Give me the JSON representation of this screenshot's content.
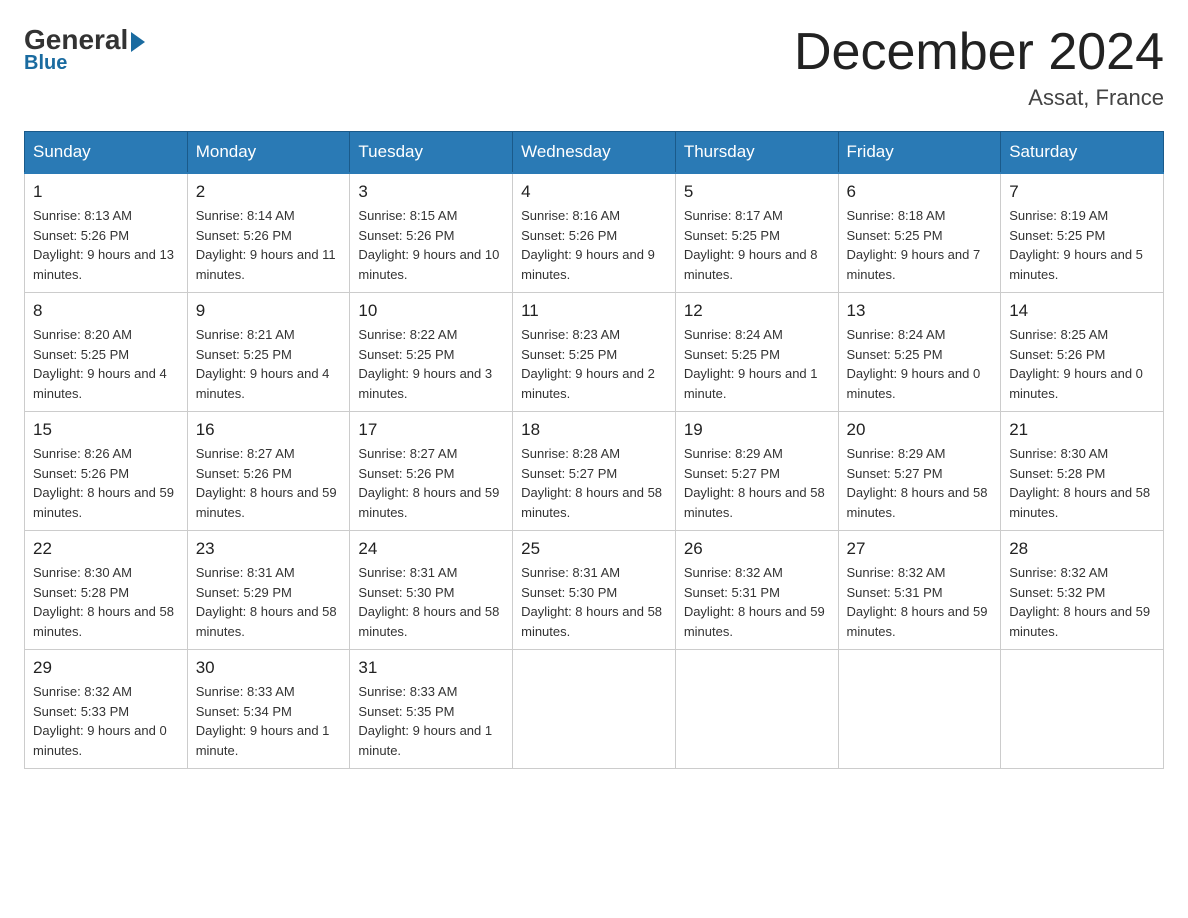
{
  "logo": {
    "general": "General",
    "blue": "Blue"
  },
  "header": {
    "month": "December 2024",
    "location": "Assat, France"
  },
  "days_of_week": [
    "Sunday",
    "Monday",
    "Tuesday",
    "Wednesday",
    "Thursday",
    "Friday",
    "Saturday"
  ],
  "weeks": [
    [
      {
        "day": "1",
        "sunrise": "Sunrise: 8:13 AM",
        "sunset": "Sunset: 5:26 PM",
        "daylight": "Daylight: 9 hours and 13 minutes."
      },
      {
        "day": "2",
        "sunrise": "Sunrise: 8:14 AM",
        "sunset": "Sunset: 5:26 PM",
        "daylight": "Daylight: 9 hours and 11 minutes."
      },
      {
        "day": "3",
        "sunrise": "Sunrise: 8:15 AM",
        "sunset": "Sunset: 5:26 PM",
        "daylight": "Daylight: 9 hours and 10 minutes."
      },
      {
        "day": "4",
        "sunrise": "Sunrise: 8:16 AM",
        "sunset": "Sunset: 5:26 PM",
        "daylight": "Daylight: 9 hours and 9 minutes."
      },
      {
        "day": "5",
        "sunrise": "Sunrise: 8:17 AM",
        "sunset": "Sunset: 5:25 PM",
        "daylight": "Daylight: 9 hours and 8 minutes."
      },
      {
        "day": "6",
        "sunrise": "Sunrise: 8:18 AM",
        "sunset": "Sunset: 5:25 PM",
        "daylight": "Daylight: 9 hours and 7 minutes."
      },
      {
        "day": "7",
        "sunrise": "Sunrise: 8:19 AM",
        "sunset": "Sunset: 5:25 PM",
        "daylight": "Daylight: 9 hours and 5 minutes."
      }
    ],
    [
      {
        "day": "8",
        "sunrise": "Sunrise: 8:20 AM",
        "sunset": "Sunset: 5:25 PM",
        "daylight": "Daylight: 9 hours and 4 minutes."
      },
      {
        "day": "9",
        "sunrise": "Sunrise: 8:21 AM",
        "sunset": "Sunset: 5:25 PM",
        "daylight": "Daylight: 9 hours and 4 minutes."
      },
      {
        "day": "10",
        "sunrise": "Sunrise: 8:22 AM",
        "sunset": "Sunset: 5:25 PM",
        "daylight": "Daylight: 9 hours and 3 minutes."
      },
      {
        "day": "11",
        "sunrise": "Sunrise: 8:23 AM",
        "sunset": "Sunset: 5:25 PM",
        "daylight": "Daylight: 9 hours and 2 minutes."
      },
      {
        "day": "12",
        "sunrise": "Sunrise: 8:24 AM",
        "sunset": "Sunset: 5:25 PM",
        "daylight": "Daylight: 9 hours and 1 minute."
      },
      {
        "day": "13",
        "sunrise": "Sunrise: 8:24 AM",
        "sunset": "Sunset: 5:25 PM",
        "daylight": "Daylight: 9 hours and 0 minutes."
      },
      {
        "day": "14",
        "sunrise": "Sunrise: 8:25 AM",
        "sunset": "Sunset: 5:26 PM",
        "daylight": "Daylight: 9 hours and 0 minutes."
      }
    ],
    [
      {
        "day": "15",
        "sunrise": "Sunrise: 8:26 AM",
        "sunset": "Sunset: 5:26 PM",
        "daylight": "Daylight: 8 hours and 59 minutes."
      },
      {
        "day": "16",
        "sunrise": "Sunrise: 8:27 AM",
        "sunset": "Sunset: 5:26 PM",
        "daylight": "Daylight: 8 hours and 59 minutes."
      },
      {
        "day": "17",
        "sunrise": "Sunrise: 8:27 AM",
        "sunset": "Sunset: 5:26 PM",
        "daylight": "Daylight: 8 hours and 59 minutes."
      },
      {
        "day": "18",
        "sunrise": "Sunrise: 8:28 AM",
        "sunset": "Sunset: 5:27 PM",
        "daylight": "Daylight: 8 hours and 58 minutes."
      },
      {
        "day": "19",
        "sunrise": "Sunrise: 8:29 AM",
        "sunset": "Sunset: 5:27 PM",
        "daylight": "Daylight: 8 hours and 58 minutes."
      },
      {
        "day": "20",
        "sunrise": "Sunrise: 8:29 AM",
        "sunset": "Sunset: 5:27 PM",
        "daylight": "Daylight: 8 hours and 58 minutes."
      },
      {
        "day": "21",
        "sunrise": "Sunrise: 8:30 AM",
        "sunset": "Sunset: 5:28 PM",
        "daylight": "Daylight: 8 hours and 58 minutes."
      }
    ],
    [
      {
        "day": "22",
        "sunrise": "Sunrise: 8:30 AM",
        "sunset": "Sunset: 5:28 PM",
        "daylight": "Daylight: 8 hours and 58 minutes."
      },
      {
        "day": "23",
        "sunrise": "Sunrise: 8:31 AM",
        "sunset": "Sunset: 5:29 PM",
        "daylight": "Daylight: 8 hours and 58 minutes."
      },
      {
        "day": "24",
        "sunrise": "Sunrise: 8:31 AM",
        "sunset": "Sunset: 5:30 PM",
        "daylight": "Daylight: 8 hours and 58 minutes."
      },
      {
        "day": "25",
        "sunrise": "Sunrise: 8:31 AM",
        "sunset": "Sunset: 5:30 PM",
        "daylight": "Daylight: 8 hours and 58 minutes."
      },
      {
        "day": "26",
        "sunrise": "Sunrise: 8:32 AM",
        "sunset": "Sunset: 5:31 PM",
        "daylight": "Daylight: 8 hours and 59 minutes."
      },
      {
        "day": "27",
        "sunrise": "Sunrise: 8:32 AM",
        "sunset": "Sunset: 5:31 PM",
        "daylight": "Daylight: 8 hours and 59 minutes."
      },
      {
        "day": "28",
        "sunrise": "Sunrise: 8:32 AM",
        "sunset": "Sunset: 5:32 PM",
        "daylight": "Daylight: 8 hours and 59 minutes."
      }
    ],
    [
      {
        "day": "29",
        "sunrise": "Sunrise: 8:32 AM",
        "sunset": "Sunset: 5:33 PM",
        "daylight": "Daylight: 9 hours and 0 minutes."
      },
      {
        "day": "30",
        "sunrise": "Sunrise: 8:33 AM",
        "sunset": "Sunset: 5:34 PM",
        "daylight": "Daylight: 9 hours and 1 minute."
      },
      {
        "day": "31",
        "sunrise": "Sunrise: 8:33 AM",
        "sunset": "Sunset: 5:35 PM",
        "daylight": "Daylight: 9 hours and 1 minute."
      },
      null,
      null,
      null,
      null
    ]
  ]
}
